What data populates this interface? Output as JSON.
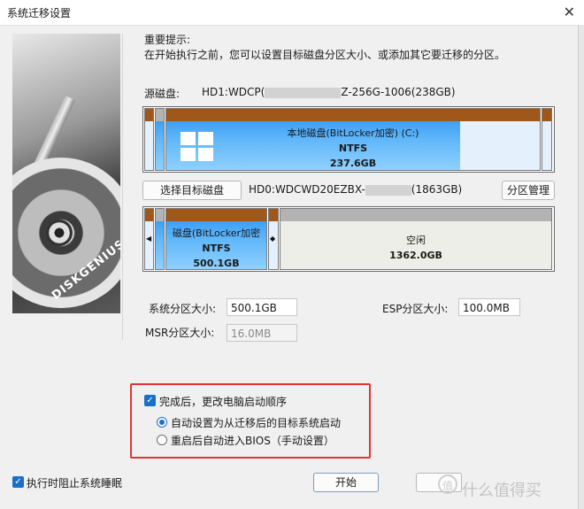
{
  "window": {
    "title": "系统迁移设置",
    "close": "✕"
  },
  "brand": {
    "name": "DISKGENIUS"
  },
  "notice": {
    "title": "重要提示:",
    "text": "在开始执行之前，您可以设置目标磁盘分区大小、或添加其它要迁移的分区。"
  },
  "source": {
    "label": "源磁盘:",
    "disk_prefix": "HD1:WDCP(",
    "disk_suffix": "Z-256G-1006(238GB)",
    "partition": {
      "name": "本地磁盘(BitLocker加密) (C:)",
      "fs": "NTFS",
      "size": "237.6GB"
    }
  },
  "target": {
    "select_button": "选择目标磁盘",
    "disk_prefix": "HD0:WDCWD20EZBX-",
    "disk_suffix": "(1863GB)",
    "manage_button": "分区管理",
    "partition": {
      "name": "磁盘(BitLocker加密",
      "fs": "NTFS",
      "size": "500.1GB"
    },
    "free": {
      "name": "空闲",
      "size": "1362.0GB"
    }
  },
  "sizes": {
    "system_label": "系统分区大小:",
    "system_value": "500.1GB",
    "esp_label": "ESP分区大小:",
    "esp_value": "100.0MB",
    "msr_label": "MSR分区大小:",
    "msr_value": "16.0MB"
  },
  "options": {
    "change_boot": "完成后，更改电脑启动顺序",
    "auto_boot": "自动设置为从迁移后的目标系统启动",
    "bios": "重启后自动进入BIOS（手动设置）",
    "prevent_sleep": "执行时阻止系统睡眠"
  },
  "buttons": {
    "start": "开始"
  },
  "watermark": {
    "text": "什么值得买",
    "icon": "值"
  },
  "colors": {
    "accent": "#1a6fc9",
    "partition_top": "#a0581a",
    "highlight": "#e23434"
  }
}
